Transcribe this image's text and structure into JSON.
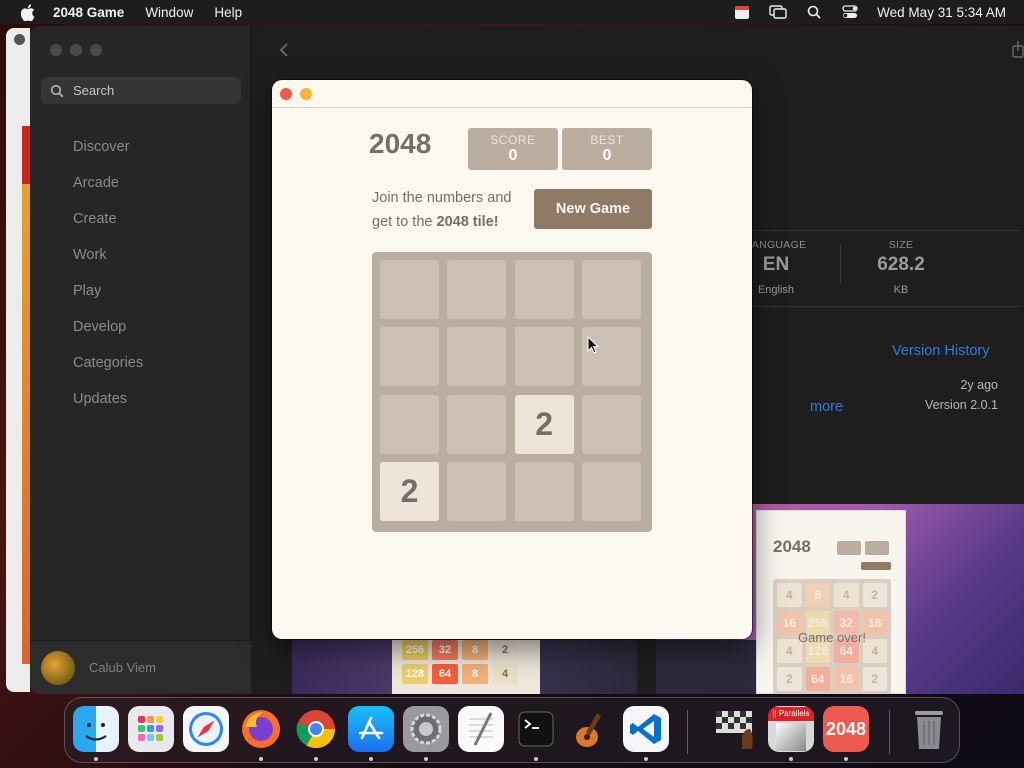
{
  "menubar": {
    "app_name": "2048 Game",
    "menus": [
      "Window",
      "Help"
    ],
    "clock": "Wed May 31  5:34 AM"
  },
  "appstore": {
    "search_placeholder": "Search",
    "nav": [
      "Discover",
      "Arcade",
      "Create",
      "Work",
      "Play",
      "Develop",
      "Categories",
      "Updates"
    ],
    "account_name": "Calub Viem",
    "info": {
      "language_label": "LANGUAGE",
      "language_value": "EN",
      "language_sub": "English",
      "size_label": "SIZE",
      "size_value": "628.2",
      "size_unit": "KB"
    },
    "version_history": "Version History",
    "ago": "2y ago",
    "more": "more",
    "version": "Version 2.0.1",
    "screenshot": {
      "title": "2048",
      "overlay": "Game over!",
      "grid": [
        "4",
        "8",
        "4",
        "2",
        "16",
        "256",
        "32",
        "16",
        "4",
        "128",
        "64",
        "4",
        "2",
        "64",
        "16",
        "2"
      ],
      "strip": [
        "256",
        "32",
        "8",
        "2",
        "128",
        "64",
        "8",
        "4"
      ]
    }
  },
  "game": {
    "title": "2048",
    "score_label": "SCORE",
    "score": "0",
    "best_label": "BEST",
    "best": "0",
    "intro_text": "Join the numbers and get to the ",
    "intro_bold": "2048 tile!",
    "new_game": "New Game",
    "tiles": [
      {
        "row": 2,
        "col": 2,
        "value": "2"
      },
      {
        "row": 3,
        "col": 0,
        "value": "2"
      }
    ]
  },
  "dock": {
    "apps": [
      "Finder",
      "Launchpad",
      "Safari",
      "Firefox",
      "Chrome",
      "App Store",
      "System Preferences",
      "TextEdit",
      "Terminal",
      "GarageBand",
      "Visual Studio Code",
      "Chess",
      "Parallels",
      "2048",
      "Trash"
    ],
    "parallels_label": "|| Parallels",
    "game_label": "2048"
  }
}
